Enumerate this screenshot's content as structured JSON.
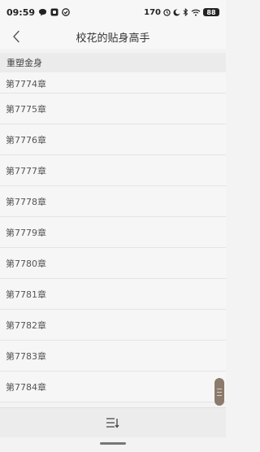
{
  "status_bar": {
    "time": "09:59",
    "right_text": "170",
    "battery": "88"
  },
  "header": {
    "title": "校花的贴身高手"
  },
  "section": {
    "title": "重塑金身"
  },
  "chapters": [
    "第7774章",
    "第7775章",
    "第7776章",
    "第7777章",
    "第7778章",
    "第7779章",
    "第7780章",
    "第7781章",
    "第7782章",
    "第7783章",
    "第7784章"
  ],
  "icons": {
    "back": "back-arrow-icon",
    "sort": "sort-order-icon",
    "scroll": "scroll-handle-icon"
  }
}
